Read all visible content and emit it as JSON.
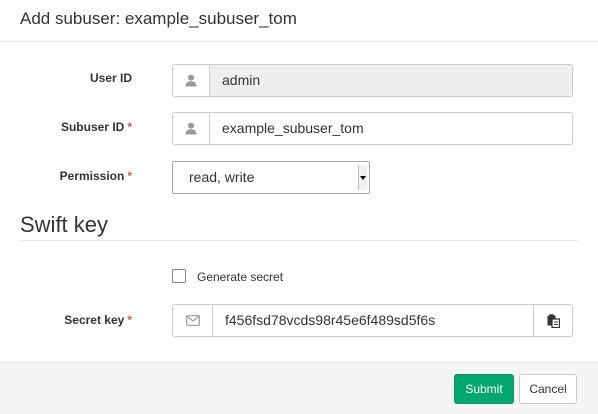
{
  "modal": {
    "title": "Add subuser: example_subuser_tom"
  },
  "form": {
    "user_id": {
      "label": "User ID",
      "value": "admin",
      "icon": "user-icon",
      "readonly": true
    },
    "subuser_id": {
      "label": "Subuser ID",
      "required_mark": "*",
      "value": "example_subuser_tom",
      "icon": "user-icon"
    },
    "permission": {
      "label": "Permission",
      "required_mark": "*",
      "selected": "read, write"
    }
  },
  "swift_key": {
    "section_title": "Swift key",
    "generate_secret": {
      "label": "Generate secret",
      "checked": false
    },
    "secret_key": {
      "label": "Secret key",
      "required_mark": "*",
      "value": "f456fsd78vcds98r45e6f489sd5f6s",
      "left_icon": "envelope-icon",
      "right_icon": "copy-icon"
    }
  },
  "footer": {
    "submit_label": "Submit",
    "cancel_label": "Cancel"
  },
  "colors": {
    "primary": "#00a870",
    "required": "#d9534f",
    "readonly_bg": "#eeeeee"
  }
}
